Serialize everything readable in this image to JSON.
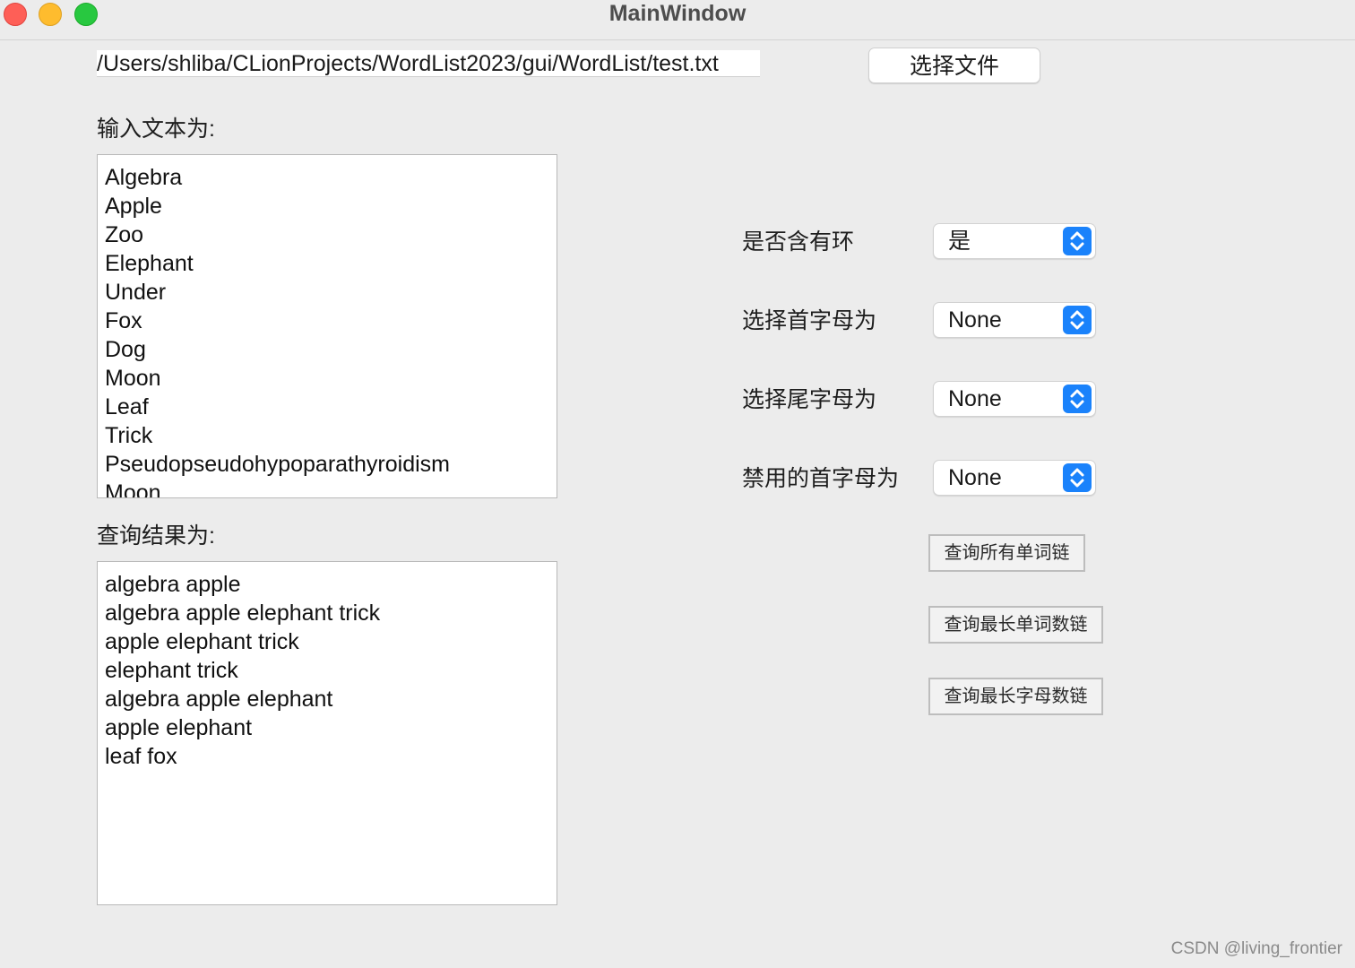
{
  "window": {
    "title": "MainWindow"
  },
  "file": {
    "path": "/Users/shliba/CLionProjects/WordList2023/gui/WordList/test.txt",
    "select_button": "选择文件"
  },
  "input": {
    "label": "输入文本为:",
    "lines": [
      "Algebra",
      "Apple",
      "Zoo",
      "Elephant",
      "Under",
      "Fox",
      "Dog",
      "Moon",
      "Leaf",
      "Trick",
      "Pseudopseudohypoparathyroidism",
      "Moon"
    ]
  },
  "result": {
    "label": "查询结果为:",
    "lines": [
      "algebra apple",
      "algebra apple elephant trick",
      "apple elephant trick",
      "elephant trick",
      "algebra apple elephant",
      "apple elephant",
      "leaf fox"
    ]
  },
  "options": {
    "has_cycle": {
      "label": "是否含有环",
      "value": "是"
    },
    "head_letter": {
      "label": "选择首字母为",
      "value": "None"
    },
    "tail_letter": {
      "label": "选择尾字母为",
      "value": "None"
    },
    "banned_head": {
      "label": "禁用的首字母为",
      "value": "None"
    }
  },
  "buttons": {
    "all_chains": "查询所有单词链",
    "max_word_chain": "查询最长单词数链",
    "max_char_chain": "查询最长字母数链"
  },
  "watermark": "CSDN @living_frontier",
  "colors": {
    "accent": "#1a82fb",
    "window_bg": "#ececec"
  }
}
